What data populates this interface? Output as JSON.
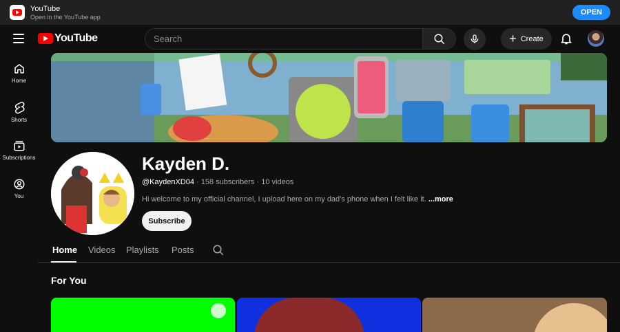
{
  "app_banner": {
    "name": "YouTube",
    "subtitle": "Open in the YouTube app",
    "open_label": "OPEN"
  },
  "header": {
    "logo_text": "YouTube",
    "search_placeholder": "Search",
    "create_label": "Create"
  },
  "sidebar": {
    "items": [
      {
        "label": "Home",
        "icon": "home-icon"
      },
      {
        "label": "Shorts",
        "icon": "shorts-icon"
      },
      {
        "label": "Subscriptions",
        "icon": "subscriptions-icon"
      },
      {
        "label": "You",
        "icon": "you-icon"
      }
    ]
  },
  "channel": {
    "name": "Kayden D.",
    "handle": "@KaydenXD04",
    "subscribers": "158 subscribers",
    "videos": "10 videos",
    "separator": " · ",
    "description": "Hi welcome to my official channel, I upload here on my dad's phone when I felt like it.",
    "more_label": "...more",
    "subscribe_label": "Subscribe"
  },
  "tabs": [
    {
      "label": "Home",
      "active": true
    },
    {
      "label": "Videos",
      "active": false
    },
    {
      "label": "Playlists",
      "active": false
    },
    {
      "label": "Posts",
      "active": false
    }
  ],
  "section": {
    "title": "For You"
  },
  "colors": {
    "background": "#0f0f0f",
    "accent_red": "#ff0000",
    "open_blue": "#1a8cff"
  }
}
